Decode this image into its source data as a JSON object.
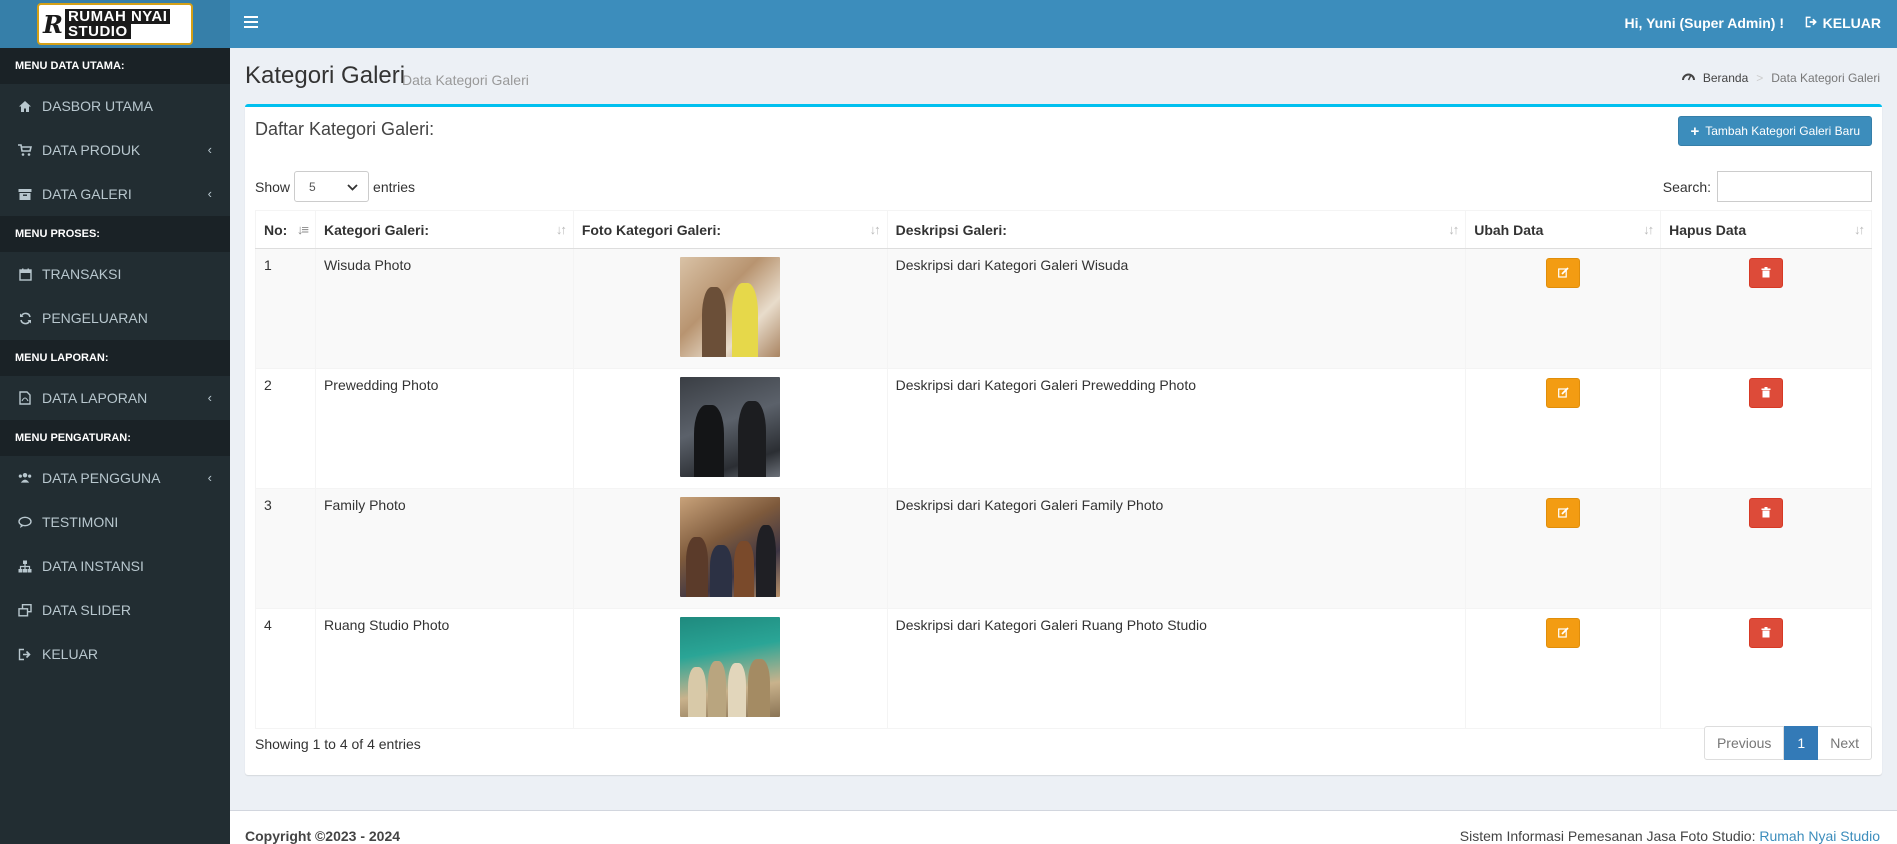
{
  "brand": {
    "mark": "R",
    "line1": "RUMAH NYAI",
    "line2": "STUDIO"
  },
  "topbar": {
    "user": "Hi, Yuni (Super Admin) !",
    "logout": "KELUAR"
  },
  "sidebar": {
    "sections": [
      {
        "header": "MENU DATA UTAMA:",
        "items": [
          {
            "label": "DASBOR UTAMA",
            "icon": "home-icon",
            "caret": false
          },
          {
            "label": "DATA PRODUK",
            "icon": "cart-icon",
            "caret": true
          },
          {
            "label": "DATA GALERI",
            "icon": "archive-icon",
            "caret": true
          }
        ]
      },
      {
        "header": "MENU PROSES:",
        "items": [
          {
            "label": "TRANSAKSI",
            "icon": "calendar-icon",
            "caret": false
          },
          {
            "label": "PENGELUARAN",
            "icon": "refresh-icon",
            "caret": false
          }
        ]
      },
      {
        "header": "MENU LAPORAN:",
        "items": [
          {
            "label": "DATA LAPORAN",
            "icon": "pdf-file-icon",
            "caret": true
          }
        ]
      },
      {
        "header": "MENU PENGATURAN:",
        "items": [
          {
            "label": "DATA PENGGUNA",
            "icon": "users-icon",
            "caret": true
          },
          {
            "label": "TESTIMONI",
            "icon": "comment-icon",
            "caret": false
          },
          {
            "label": "DATA INSTANSI",
            "icon": "sitemap-icon",
            "caret": false
          },
          {
            "label": "DATA SLIDER",
            "icon": "clone-icon",
            "caret": false
          },
          {
            "label": "KELUAR",
            "icon": "sign-out-icon",
            "caret": false
          }
        ]
      }
    ]
  },
  "header": {
    "title": "Kategori Galeri",
    "subtitle": "Data Kategori Galeri",
    "breadcrumb": {
      "home": "Beranda",
      "current": "Data Kategori Galeri"
    }
  },
  "box": {
    "title": "Daftar Kategori Galeri:",
    "add_button": "Tambah Kategori Galeri Baru",
    "show_label": "Show",
    "entries_label": "entries",
    "page_length": "5",
    "search_label": "Search:",
    "search_value": ""
  },
  "table": {
    "columns": [
      "No:",
      "Kategori Galeri:",
      "Foto Kategori Galeri:",
      "Deskripsi Galeri:",
      "Ubah Data",
      "Hapus Data"
    ],
    "rows": [
      {
        "no": "1",
        "kategori": "Wisuda Photo",
        "deskripsi": "Deskripsi dari Kategori Galeri Wisuda"
      },
      {
        "no": "2",
        "kategori": "Prewedding Photo",
        "deskripsi": "Deskripsi dari Kategori Galeri Prewedding Photo"
      },
      {
        "no": "3",
        "kategori": "Family Photo",
        "deskripsi": "Deskripsi dari Kategori Galeri Family Photo"
      },
      {
        "no": "4",
        "kategori": "Ruang Studio Photo",
        "deskripsi": "Deskripsi dari Kategori Galeri Ruang Photo Studio"
      }
    ]
  },
  "pagination": {
    "info": "Showing 1 to 4 of 4 entries",
    "previous": "Previous",
    "current": "1",
    "next": "Next"
  },
  "footer": {
    "copyright": "Copyright ©2023 - 2024",
    "text": "Sistem Informasi Pemesanan Jasa Foto Studio:",
    "link": "Rumah Nyai Studio"
  },
  "colors": {
    "topbar": "#3c8dbc",
    "sidebar": "#222d32",
    "box_accent": "#00c0ef",
    "edit": "#f39c12",
    "delete": "#dd4b39"
  }
}
